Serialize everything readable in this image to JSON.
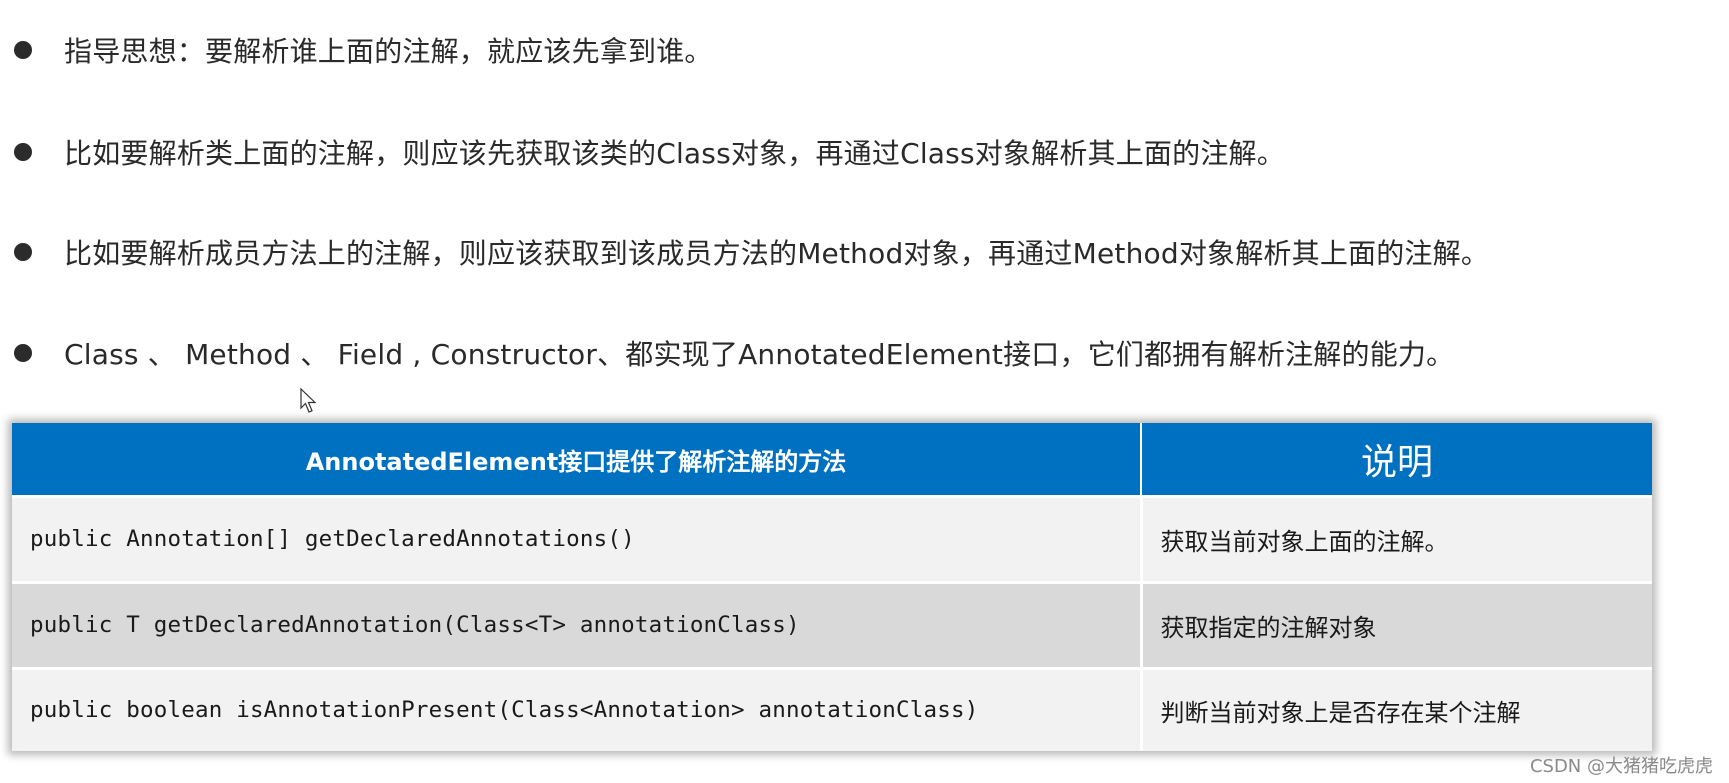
{
  "bullets": [
    {
      "text": "指导思想：要解析谁上面的注解，就应该先拿到谁。"
    },
    {
      "text": "比如要解析类上面的注解，则应该先获取该类的Class对象，再通过Class对象解析其上面的注解。"
    },
    {
      "text": "比如要解析成员方法上的注解，则应该获取到该成员方法的Method对象，再通过Method对象解析其上面的注解。"
    },
    {
      "text": "Class 、 Method 、 Field , Constructor、都实现了AnnotatedElement接口，它们都拥有解析注解的能力。"
    }
  ],
  "table": {
    "headers": [
      "AnnotatedElement接口提供了解析注解的方法",
      "说明"
    ],
    "rows": [
      {
        "method": "public Annotation[] getDeclaredAnnotations()",
        "description": "获取当前对象上面的注解。"
      },
      {
        "method": "public T getDeclaredAnnotation(Class<T> annotationClass)",
        "description": "获取指定的注解对象"
      },
      {
        "method": "public boolean isAnnotationPresent(Class<Annotation> annotationClass)",
        "description": "判断当前对象上是否存在某个注解"
      }
    ]
  },
  "colors": {
    "header_bg": "#0070c0",
    "row_light": "#f2f2f2",
    "row_dark": "#d9d9d9"
  },
  "watermark": "CSDN @大猪猪吃虎虎"
}
